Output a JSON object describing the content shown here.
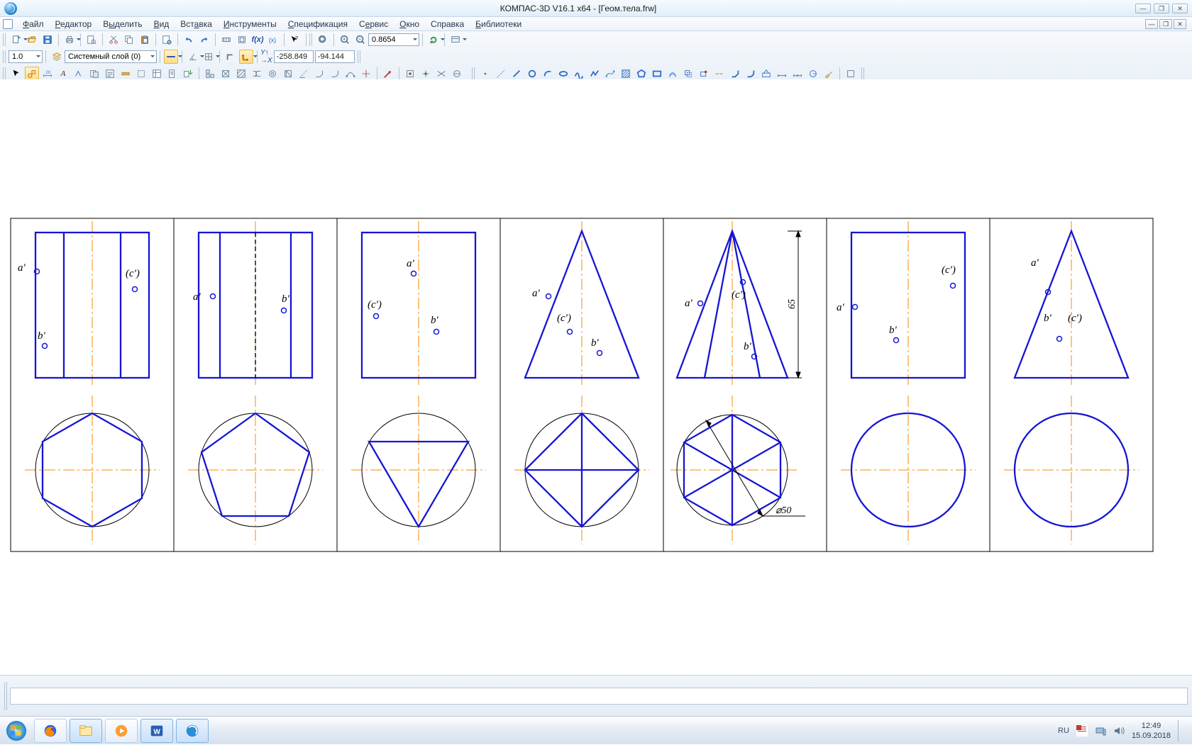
{
  "title": "КОМПАС-3D V16.1 x64 - [Геом.тела.frw]",
  "menu": [
    "Файл",
    "Редактор",
    "Выделить",
    "Вид",
    "Вставка",
    "Инструменты",
    "Спецификация",
    "Сервис",
    "Окно",
    "Справка",
    "Библиотеки"
  ],
  "win_buttons": [
    "—",
    "❐",
    "✕"
  ],
  "doc_buttons": [
    "—",
    "❐",
    "✕"
  ],
  "tb2": {
    "line_scale": "1.0",
    "layer": "Системный слой (0)",
    "coord_x": "-258.849",
    "coord_y": "-94.144"
  },
  "zoom_combo": "0.8654",
  "drawing": {
    "panels": 7,
    "dim_height": "65",
    "dim_diameter": "⌀50",
    "labels": {
      "a": "a'",
      "b": "b'",
      "c": "(c')"
    }
  },
  "taskbar": {
    "lang": "RU",
    "time": "12:49",
    "date": "15.09.2018"
  }
}
